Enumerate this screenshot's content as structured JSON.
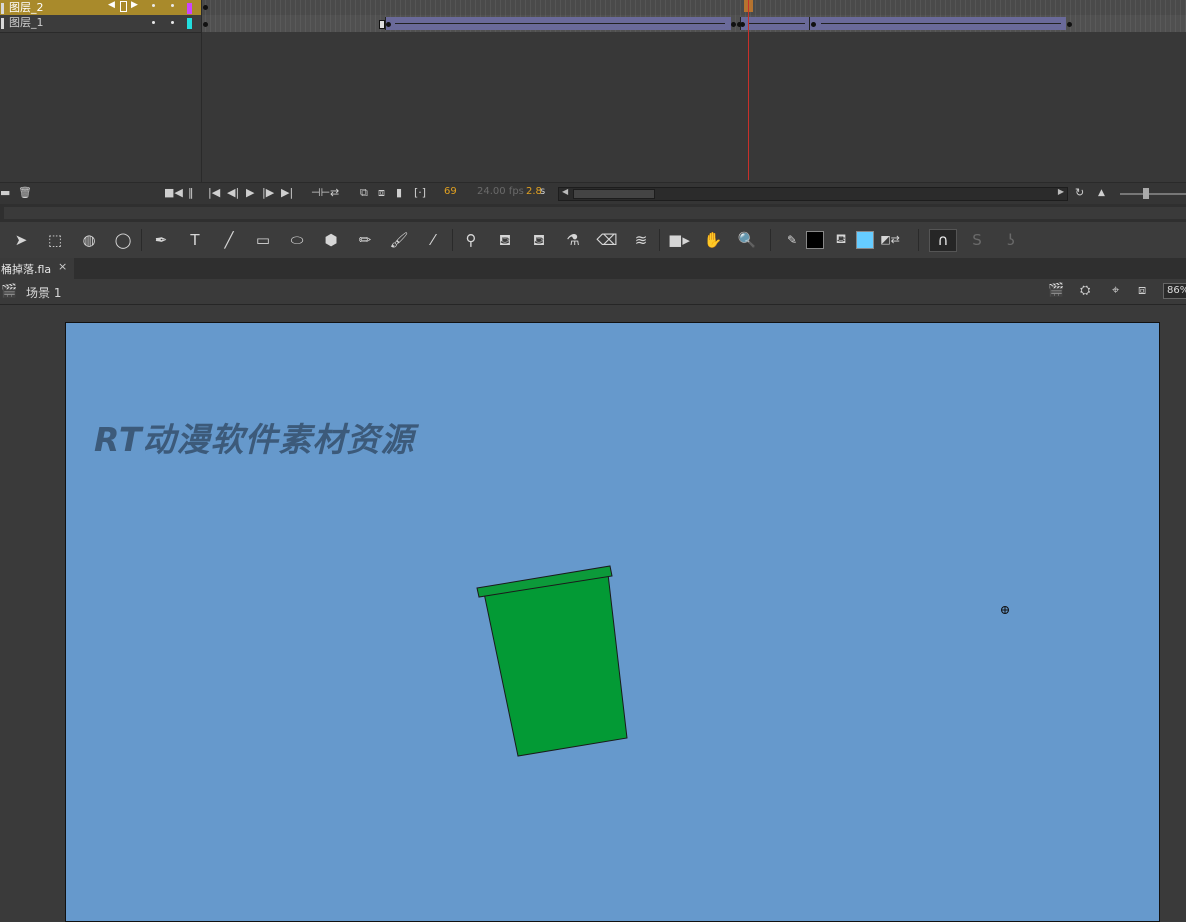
{
  "timeline": {
    "layers": [
      {
        "name": "图层_2",
        "selected": true,
        "color": "#cc44ff"
      },
      {
        "name": "图层_1",
        "selected": false,
        "color": "#22dddd"
      }
    ],
    "current_frame": "69",
    "fps": "24.00 fps",
    "elapsed_time": "2.8",
    "elapsed_unit": "s"
  },
  "tools": [
    "selection-tool",
    "subselection-tool",
    "3d-rotation-tool",
    "lasso-tool",
    "pen-tool",
    "text-tool",
    "line-tool",
    "rectangle-tool",
    "oval-tool",
    "polystar-tool",
    "pencil-tool",
    "brush-tool",
    "paint-brush-tool",
    "bone-tool",
    "paint-bucket-tool",
    "ink-bottle-tool",
    "eyedropper-tool",
    "eraser-tool",
    "width-tool",
    "camera-tool",
    "hand-tool",
    "zoom-tool"
  ],
  "colors": {
    "stroke": "#000000",
    "fill": "#66ccff",
    "stage_background": "#6699cc",
    "bucket_fill": "#039a35"
  },
  "document": {
    "tab_name": "桶掉落.fla",
    "close_glyph": "×",
    "scene": "场景 1",
    "zoom": "86%"
  },
  "stage": {
    "watermark": "RT动漫软件素材资源"
  }
}
